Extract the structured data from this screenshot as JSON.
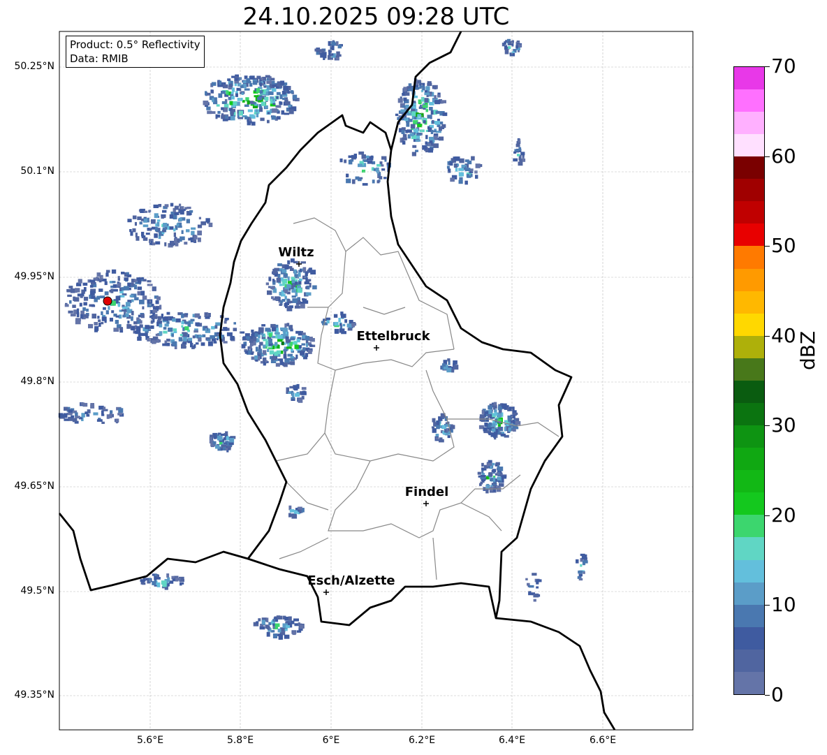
{
  "title": "24.10.2025 09:28 UTC",
  "legend": {
    "product": "Product: 0.5° Reflectivity",
    "data": "Data: RMIB"
  },
  "axes": {
    "lat_ticks": [
      "50.25°N",
      "50.1°N",
      "49.95°N",
      "49.8°N",
      "49.65°N",
      "49.5°N",
      "49.35°N"
    ],
    "lon_ticks": [
      "5.6°E",
      "5.8°E",
      "6°E",
      "6.2°E",
      "6.4°E",
      "6.6°E"
    ]
  },
  "colorbar": {
    "label": "dBZ",
    "ticks": [
      "0",
      "10",
      "20",
      "30",
      "40",
      "50",
      "60",
      "70"
    ],
    "colors": [
      "#6474a8",
      "#5065a0",
      "#3f5ba0",
      "#4a78b0",
      "#5b9dc8",
      "#63bfdc",
      "#60d6c4",
      "#3cd66e",
      "#14c81e",
      "#12b815",
      "#10a812",
      "#0e9412",
      "#0b7410",
      "#0a5c10",
      "#48781a",
      "#aeb00a",
      "#ffd800",
      "#ffb800",
      "#ff9a00",
      "#ff7a00",
      "#e80000",
      "#c00000",
      "#a00000",
      "#7a0000",
      "#ffe0ff",
      "#ffb0ff",
      "#ff70ff",
      "#e838e8"
    ]
  },
  "cities": [
    "Wiltz",
    "Ettelbruck",
    "Findel",
    "Esch/Alzette"
  ]
}
